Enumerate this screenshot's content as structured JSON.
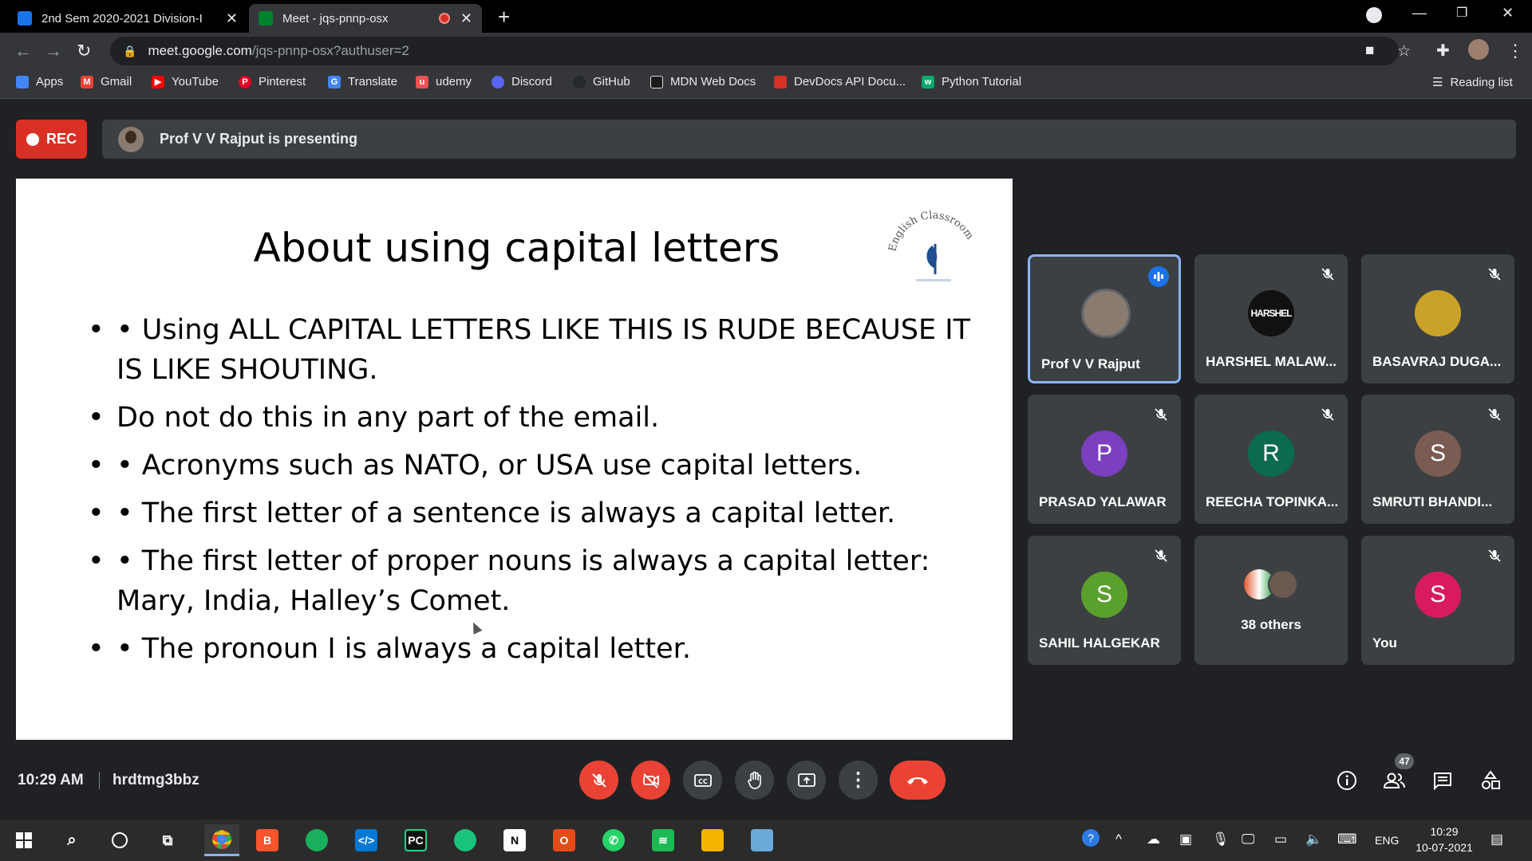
{
  "browser": {
    "tabs": [
      {
        "title": "2nd Sem 2020-2021 Division-I",
        "favicon_color": "#1a73e8"
      },
      {
        "title": "Meet - jqs-pnnp-osx",
        "favicon_color": "#00832d",
        "active": true
      }
    ],
    "url_host": "meet.google.com",
    "url_path": "/jqs-pnnp-osx?authuser=2",
    "bookmarks": [
      {
        "label": "Apps",
        "icon": "apps-grid-icon",
        "color": "#4285f4"
      },
      {
        "label": "Gmail",
        "icon": "gmail-icon",
        "color": "#ea4335"
      },
      {
        "label": "YouTube",
        "icon": "youtube-icon",
        "color": "#ff0000"
      },
      {
        "label": "Pinterest",
        "icon": "pinterest-icon",
        "color": "#e60023"
      },
      {
        "label": "Translate",
        "icon": "translate-icon",
        "color": "#4285f4"
      },
      {
        "label": "udemy",
        "icon": "udemy-icon",
        "color": "#ec5252"
      },
      {
        "label": "Discord",
        "icon": "discord-icon",
        "color": "#5865f2"
      },
      {
        "label": "GitHub",
        "icon": "github-icon",
        "color": "#24292e"
      },
      {
        "label": "MDN Web Docs",
        "icon": "mdn-icon",
        "color": "#1b1b1b"
      },
      {
        "label": "DevDocs API Docu...",
        "icon": "devdocs-icon",
        "color": "#d93025"
      },
      {
        "label": "Python Tutorial",
        "icon": "w3schools-icon",
        "color": "#04aa6d"
      }
    ],
    "reading_list": "Reading list"
  },
  "meet": {
    "rec_label": "REC",
    "presenting_text": "Prof V V Rajput is presenting",
    "slide": {
      "title": "About using capital letters",
      "logo_text": "English Classroom",
      "bullets": [
        "• Using ALL CAPITAL LETTERS LIKE THIS IS RUDE BECAUSE IT IS LIKE SHOUTING.",
        "Do not do this in any part of the email.",
        "• Acronyms such as NATO, or USA use capital letters.",
        "• The first letter of a sentence is always a capital letter.",
        "• The first letter of proper nouns is always a capital letter: Mary, India, Halley’s Comet.",
        "• The pronoun I is always a capital letter."
      ]
    },
    "participants": [
      {
        "name": "Prof V V Rajput",
        "initial": "",
        "color": "#8a7b70",
        "speaking": true
      },
      {
        "name": "HARSHEL MALAW...",
        "initial": "HARSHEL",
        "color": "#111111",
        "muted": true
      },
      {
        "name": "BASAVRAJ DUGA...",
        "initial": "",
        "color": "#c9a227",
        "muted": true
      },
      {
        "name": "PRASAD YALAWAR",
        "initial": "P",
        "color": "#7b3fbf",
        "muted": true
      },
      {
        "name": "REECHA TOPINKA...",
        "initial": "R",
        "color": "#0b6b4f",
        "muted": true
      },
      {
        "name": "SMRUTI BHANDI...",
        "initial": "S",
        "color": "#7a5c52",
        "muted": true
      },
      {
        "name": "SAHIL HALGEKAR",
        "initial": "S",
        "color": "#5aa02c",
        "muted": true
      },
      {
        "name": "38 others",
        "initial": "",
        "color": "#5f6368"
      },
      {
        "name": "You",
        "initial": "S",
        "color": "#d81b60",
        "muted": true
      }
    ],
    "time": "10:29 AM",
    "meeting_code": "hrdtmg3bbz",
    "participant_count": "47"
  },
  "taskbar": {
    "clock_time": "10:29",
    "clock_date": "10-07-2021",
    "language": "ENG"
  }
}
